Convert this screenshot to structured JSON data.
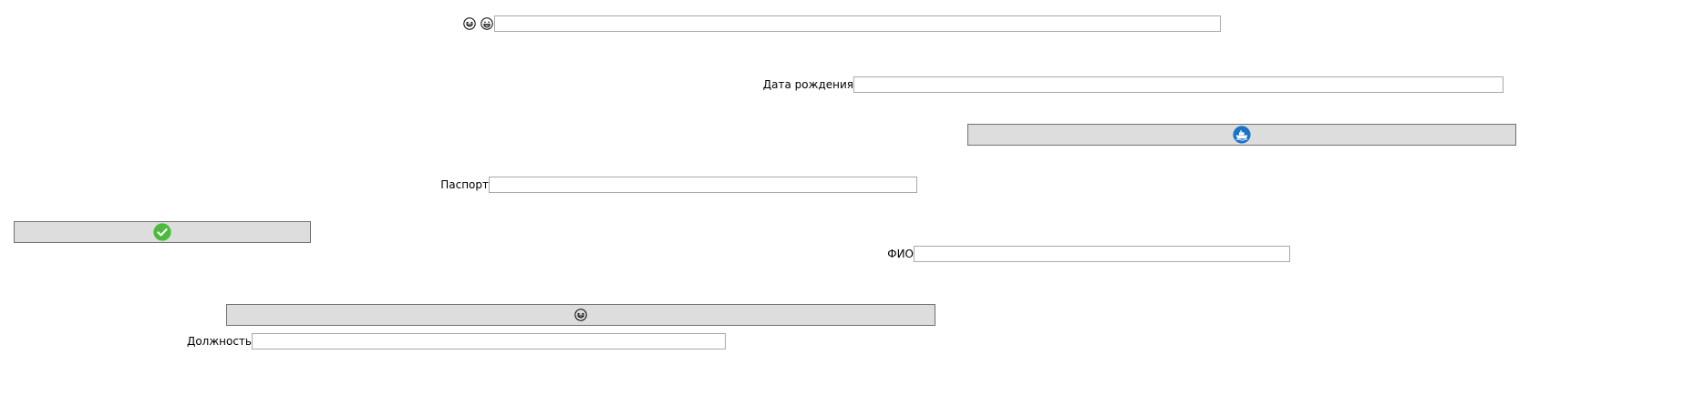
{
  "form": {
    "top_icons": [
      "laughing-face-icon",
      "grinning-face-icon"
    ],
    "top_field": {
      "value": "",
      "placeholder": ""
    },
    "birth_date": {
      "label": "Дата рождения",
      "value": "",
      "placeholder": ""
    },
    "ship_button": {
      "icon": "ship-icon",
      "accent": "#1a73c8"
    },
    "passport": {
      "label": "Паспорт",
      "value": "",
      "placeholder": ""
    },
    "confirm_button": {
      "icon": "check-circle-icon",
      "accent": "#4cba3c"
    },
    "full_name": {
      "label": "ФИО",
      "value": "",
      "placeholder": ""
    },
    "emoji_button": {
      "icon": "laughing-face-icon"
    },
    "position": {
      "label": "Должность",
      "value": "",
      "placeholder": ""
    }
  }
}
